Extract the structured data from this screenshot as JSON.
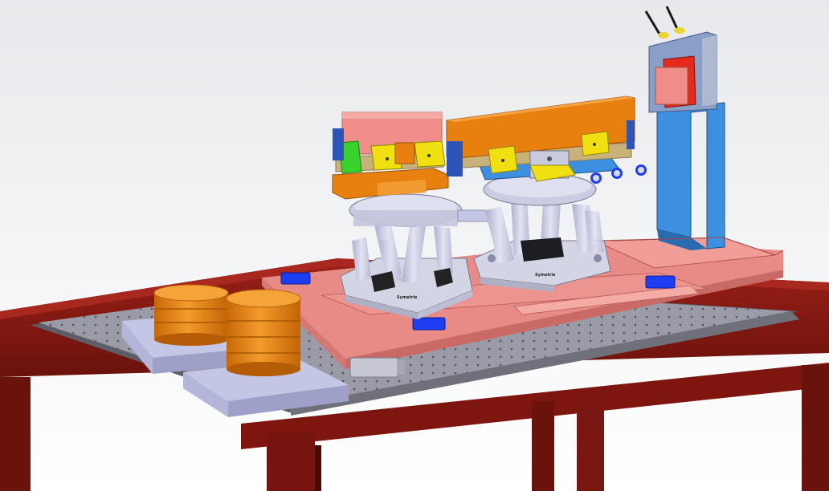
{
  "scene": {
    "brand_mark_left": "Symetrie",
    "brand_mark_right": "Symetrie"
  },
  "colors": {
    "background_top": "#e9ebee",
    "background_bottom": "#ffffff",
    "table_frame": "#8b1a12",
    "table_frame_dark": "#5e0f0a",
    "breadboard": "#9a9ba6",
    "breadboard_edge": "#6f707a",
    "base_plate": "#e88a86",
    "hexapod_strut": "#c9cbe3",
    "hexapod_base": "#d4d5e4",
    "orange_part": "#e88010",
    "pink_part": "#ef8e88",
    "yellow_bracket": "#f0e012",
    "green_bracket": "#39d12b",
    "blue_part": "#3d8fe0",
    "tan_plate": "#c9b27a",
    "clamp_blue": "#1c3ef0",
    "riser_lavender": "#c4c6e6"
  },
  "icons": {
    "hexapod_left": "hexapod-icon",
    "hexapod_right": "hexapod-icon",
    "optical_table": "optical-table-icon"
  }
}
